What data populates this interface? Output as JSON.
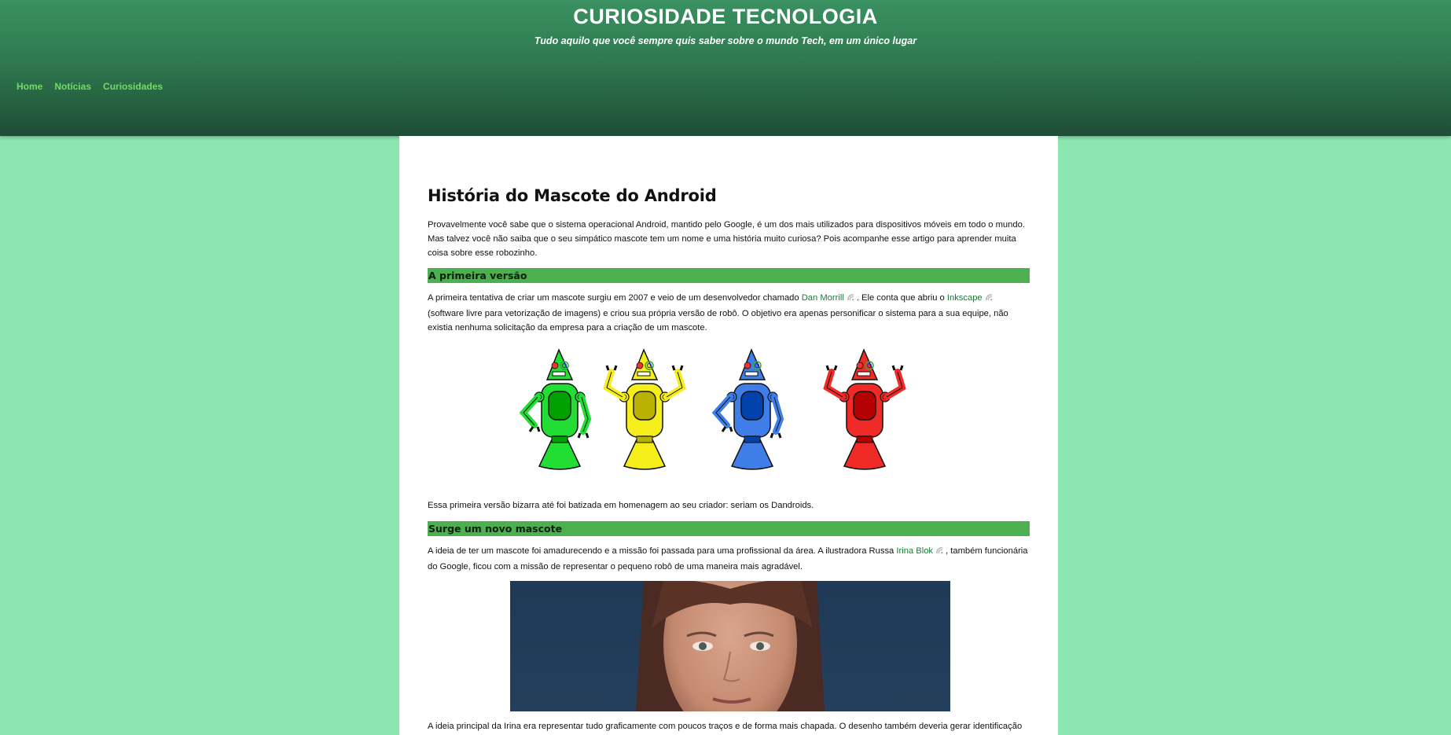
{
  "site": {
    "title": "CURIOSIDADE TECNOLOGIA",
    "subtitle": "Tudo aquilo que você sempre quis saber sobre o mundo Tech, em um único lugar"
  },
  "nav": {
    "items": [
      "Home",
      "Notícias",
      "Curiosidades"
    ]
  },
  "article": {
    "title": "História do Mascote do Android",
    "intro": "Provavelmente você sabe que o sistema operacional Android, mantido pelo Google, é um dos mais utilizados para dispositivos móveis em todo o mundo. Mas talvez você não saiba que o seu simpático mascote tem um nome e uma história muito curiosa? Pois acompanhe esse artigo para aprender muita coisa sobre esse robozinho.",
    "section1": {
      "heading": "A primeira versão",
      "p1_a": "A primeira tentativa de criar um mascote surgiu em 2007 e veio de um desenvolvedor chamado ",
      "link1": "Dan Morrill",
      "p1_b": ". Ele conta que abriu o ",
      "link2": "Inkscape",
      "p1_c": " (software livre para vetorização de imagens) e criou sua própria versão de robô. O objetivo era apenas personificar o sistema para a sua equipe, não existia nenhuma solicitação da empresa para a criação de um mascote.",
      "robots_colors": [
        "#22dd33",
        "#f5ee1a",
        "#3f7ee8",
        "#f02a26"
      ],
      "after_image": "Essa primeira versão bizarra até foi batizada em homenagem ao seu criador: seriam os Dandroids."
    },
    "section2": {
      "heading": "Surge um novo mascote",
      "p_a": "A ideia de ter um mascote foi amadurecendo e a missão foi passada para uma profissional da área. A ilustradora Russa ",
      "link": "Irina Blok",
      "p_b": ", também funcionária do Google, ficou com a missão de representar o pequeno robô de uma maneira mais agradável.",
      "after_photo": "A ideia principal da Irina era representar tudo graficamente com poucos traços e de forma mais chapada. O desenho também deveria gerar identificação"
    }
  }
}
